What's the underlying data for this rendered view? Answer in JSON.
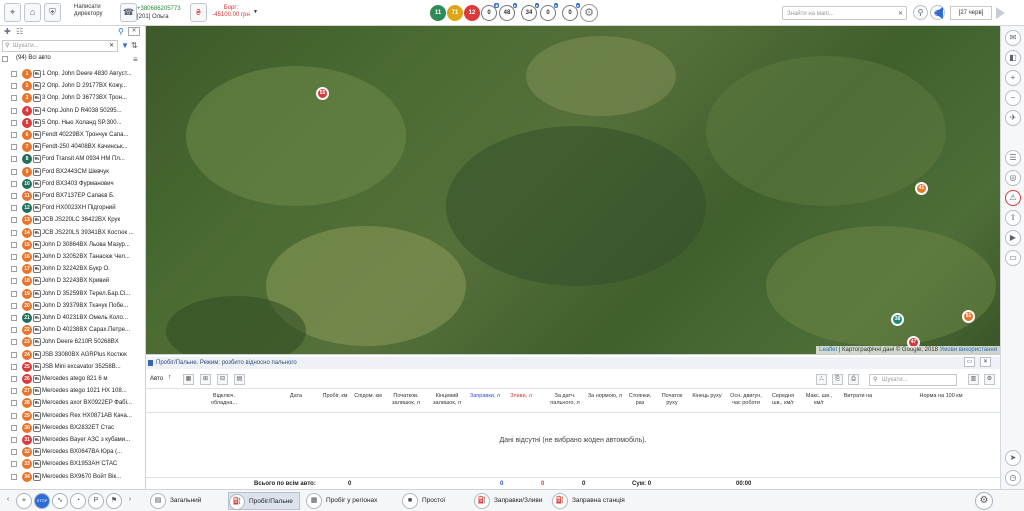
{
  "topbar": {
    "write_director": "Написати директору",
    "contact_phone": "+380686205773",
    "contact_name": "[201] Ольга",
    "debt_label": "Борг:",
    "debt_value": "-45100.00 грн",
    "counters": [
      {
        "value": "11",
        "color": "#2e8b57",
        "outline": false
      },
      {
        "value": "71",
        "color": "#e0a516",
        "outline": false
      },
      {
        "value": "12",
        "color": "#d93a3a",
        "outline": false
      },
      {
        "value": "0",
        "color": "#ffffff",
        "outline": true,
        "badge": "₴"
      },
      {
        "value": "48",
        "color": "#ffffff",
        "outline": true,
        "badge": "●"
      },
      {
        "value": "34",
        "color": "#ffffff",
        "outline": true,
        "badge": "●"
      },
      {
        "value": "0",
        "color": "#ffffff",
        "outline": true,
        "badge": "●"
      },
      {
        "value": "0",
        "color": "#ffffff",
        "outline": true,
        "badge": "●"
      }
    ],
    "map_search_placeholder": "Знайти на мапі...",
    "date": "[27 черв]"
  },
  "sidebar": {
    "search_placeholder": "Шукати...",
    "all_group": "(94) Всі авто",
    "vehicles": [
      {
        "n": "1",
        "c": "#e8732a",
        "label": "1 Опр. John Deere 4830 Август..."
      },
      {
        "n": "2",
        "c": "#e8732a",
        "label": "2 Опр. John D 29177BX Кожу..."
      },
      {
        "n": "3",
        "c": "#e8732a",
        "label": "3 Опр. John D 36773BX Трон..."
      },
      {
        "n": "4",
        "c": "#d93a3a",
        "label": "4 Опр.John D R4038 50295..."
      },
      {
        "n": "5",
        "c": "#d93a3a",
        "label": "5 Опр. Нью Холанд SP.300..."
      },
      {
        "n": "6",
        "c": "#e8732a",
        "label": "Fendt 40229BX Трончук Сапа..."
      },
      {
        "n": "7",
        "c": "#e8732a",
        "label": "Fendt-250 40408BX Качинськ..."
      },
      {
        "n": "8",
        "c": "#1f6f5c",
        "label": "Ford Transit AM 0934 HM Пл..."
      },
      {
        "n": "9",
        "c": "#e8732a",
        "label": "Ford BX2443CM Шевчук"
      },
      {
        "n": "10",
        "c": "#1f6f5c",
        "label": "Ford BX3403 Фурманович"
      },
      {
        "n": "11",
        "c": "#e8732a",
        "label": "Ford BX7137EP Сапаєв Б."
      },
      {
        "n": "12",
        "c": "#1f6f5c",
        "label": "Ford HX0023XH Підгорний"
      },
      {
        "n": "13",
        "c": "#e8732a",
        "label": "JCB JS220LC 36422BX Крук"
      },
      {
        "n": "14",
        "c": "#e8732a",
        "label": "JCB JS220LS 39341BX Костюк ..."
      },
      {
        "n": "15",
        "c": "#e8732a",
        "label": "John D 30864BX Льова Мазур..."
      },
      {
        "n": "16",
        "c": "#e8732a",
        "label": "John D 32052BX Танасюк Чел..."
      },
      {
        "n": "17",
        "c": "#e8732a",
        "label": "John D 32242BX Букр О."
      },
      {
        "n": "18",
        "c": "#e8732a",
        "label": "John D 32243BX Кривий"
      },
      {
        "n": "19",
        "c": "#e8732a",
        "label": "John D 35259BX Терел.Бар.Сі..."
      },
      {
        "n": "20",
        "c": "#e8732a",
        "label": "John D 39379BX Ткачук Побе..."
      },
      {
        "n": "21",
        "c": "#1f6f5c",
        "label": "John D 40231BX Омель Коло..."
      },
      {
        "n": "22",
        "c": "#e8732a",
        "label": "John D 40238BX Сарах.Петре..."
      },
      {
        "n": "23",
        "c": "#e8732a",
        "label": "John Deere 6210R 50268BX"
      },
      {
        "n": "24",
        "c": "#e8732a",
        "label": "JSB 33080BX AGRPlus Костюк"
      },
      {
        "n": "25",
        "c": "#d93a3a",
        "label": "JSB Mini excavator 35258B..."
      },
      {
        "n": "26",
        "c": "#d93a3a",
        "label": "Mercedes atego 821 6 м"
      },
      {
        "n": "27",
        "c": "#e8732a",
        "label": "Mercedes atego 1021 HX 108..."
      },
      {
        "n": "28",
        "c": "#e8732a",
        "label": "Mercedes axor BX0922EP Фабі..."
      },
      {
        "n": "29",
        "c": "#e8732a",
        "label": "Mercedes Rex HX0871AB Кача..."
      },
      {
        "n": "30",
        "c": "#e8732a",
        "label": "Mercedes BX2832ET Стас"
      },
      {
        "n": "31",
        "c": "#d93a3a",
        "label": "Mercedes Bayer АЗС з кубами..."
      },
      {
        "n": "32",
        "c": "#e8732a",
        "label": "Mercedes BX0647BA Юра (..."
      },
      {
        "n": "33",
        "c": "#e8732a",
        "label": "Mercedes BX1953AH СТАС"
      },
      {
        "n": "34",
        "c": "#e8732a",
        "label": "Mercedes BX9670 Войт Вік..."
      }
    ]
  },
  "map": {
    "markers": [
      {
        "value": "55",
        "color": "#d93a3a"
      },
      {
        "value": "41",
        "color": "#e8732a"
      },
      {
        "value": "38",
        "color": "#1f8a7a"
      },
      {
        "value": "51",
        "color": "#e8732a"
      },
      {
        "value": "47",
        "color": "#d93a3a"
      }
    ],
    "attribution_leaflet": "Leaflet",
    "attribution_text": "| Картографічні дані © Google, 2018",
    "attribution_terms": "Умови використання"
  },
  "report": {
    "title": "Пробіг/Пальне. Режим: розбито відносно пального",
    "auto_label": "Авто",
    "search_placeholder": "Шукати...",
    "columns": [
      {
        "label": "Відключ. обладна...",
        "color": "#333"
      },
      {
        "label": "Дата",
        "color": "#333"
      },
      {
        "label": "Пробіг, км",
        "color": "#333"
      },
      {
        "label": "Спідом. км",
        "color": "#333"
      },
      {
        "label": "Початков. залишок, л",
        "color": "#333"
      },
      {
        "label": "Кінцевий залишок, л",
        "color": "#333"
      },
      {
        "label": "Заправки, л",
        "color": "#2b4fd8"
      },
      {
        "label": "Зливи, л",
        "color": "#d93a3a"
      },
      {
        "label": "За датч. пального, л",
        "color": "#333"
      },
      {
        "label": "За нормою, л",
        "color": "#333"
      },
      {
        "label": "Стоянки, раз",
        "color": "#333"
      },
      {
        "label": "Початок руху",
        "color": "#333"
      },
      {
        "label": "Кінець руху",
        "color": "#333"
      },
      {
        "label": "Осн. двигун, час роботи",
        "color": "#333"
      },
      {
        "label": "Середня шв., км/г",
        "color": "#333"
      },
      {
        "label": "Макс. шв., км/г",
        "color": "#333"
      },
      {
        "label": "Витрати на",
        "color": "#333"
      },
      {
        "label": "Норма на 100 км",
        "color": "#333"
      }
    ],
    "empty_message": "Дані відсутні (не вибрано жоден автомобіль).",
    "totals": {
      "label": "Всього по всім авто:",
      "mileage": "0",
      "refuel": "0",
      "drain": "0",
      "by_sensor": "0",
      "sum_label": "Сум: 0",
      "engine_time": "00:00"
    }
  },
  "bottom_tabs": [
    {
      "label": "Загальний",
      "active": false
    },
    {
      "label": "Пробіг/Пальне",
      "active": true
    },
    {
      "label": "Пробіг у регіонах",
      "active": false
    },
    {
      "label": "Простої",
      "active": false
    },
    {
      "label": "Заправки/Зливи",
      "active": false
    },
    {
      "label": "Заправна станція",
      "active": false
    }
  ]
}
